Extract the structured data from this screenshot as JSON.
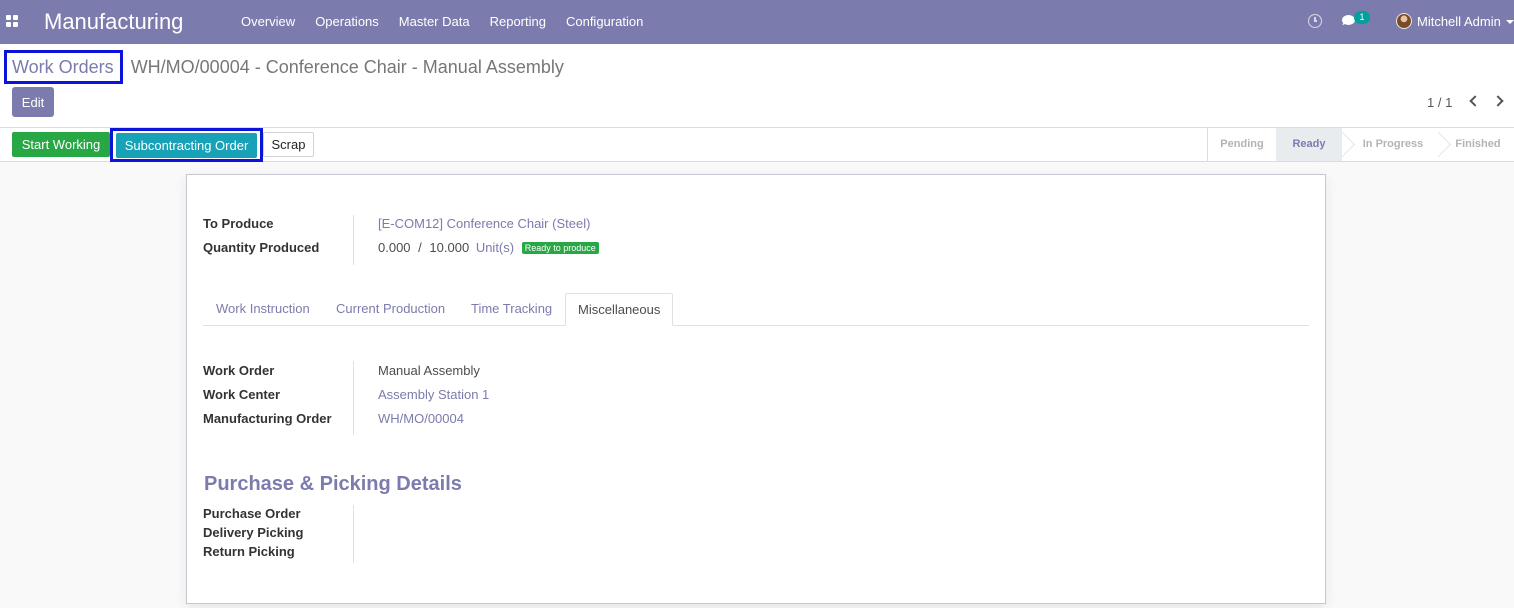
{
  "navbar": {
    "brand": "Manufacturing",
    "menu": [
      "Overview",
      "Operations",
      "Master Data",
      "Reporting",
      "Configuration"
    ],
    "messages_count": "1",
    "user_name": "Mitchell Admin",
    "bg_color": "#7c7bad"
  },
  "breadcrumb": {
    "parent": "Work Orders",
    "current": "WH/MO/00004 - Conference Chair - Manual Assembly"
  },
  "control": {
    "edit_label": "Edit",
    "pager": "1 / 1"
  },
  "statusbar": {
    "buttons": {
      "start": "Start Working",
      "subcontracting": "Subcontracting Order",
      "scrap": "Scrap"
    },
    "stages": [
      "Pending",
      "Ready",
      "In Progress",
      "Finished"
    ],
    "current_stage": "Ready"
  },
  "form": {
    "to_produce_label": "To Produce",
    "to_produce_value": "[E-COM12] Conference Chair (Steel)",
    "qty_label": "Quantity Produced",
    "qty_done": "0.000",
    "qty_sep": "/",
    "qty_total": "10.000",
    "qty_uom": "Unit(s)",
    "qty_badge": "Ready to produce",
    "tabs": [
      "Work Instruction",
      "Current Production",
      "Time Tracking",
      "Miscellaneous"
    ],
    "active_tab": "Miscellaneous",
    "misc": {
      "work_order_label": "Work Order",
      "work_order_value": "Manual Assembly",
      "work_center_label": "Work Center",
      "work_center_value": "Assembly Station 1",
      "mo_label": "Manufacturing Order",
      "mo_value": "WH/MO/00004"
    },
    "purchase_section": {
      "title": "Purchase & Picking Details",
      "purchase_order_label": "Purchase Order",
      "delivery_picking_label": "Delivery Picking",
      "return_picking_label": "Return Picking"
    }
  }
}
